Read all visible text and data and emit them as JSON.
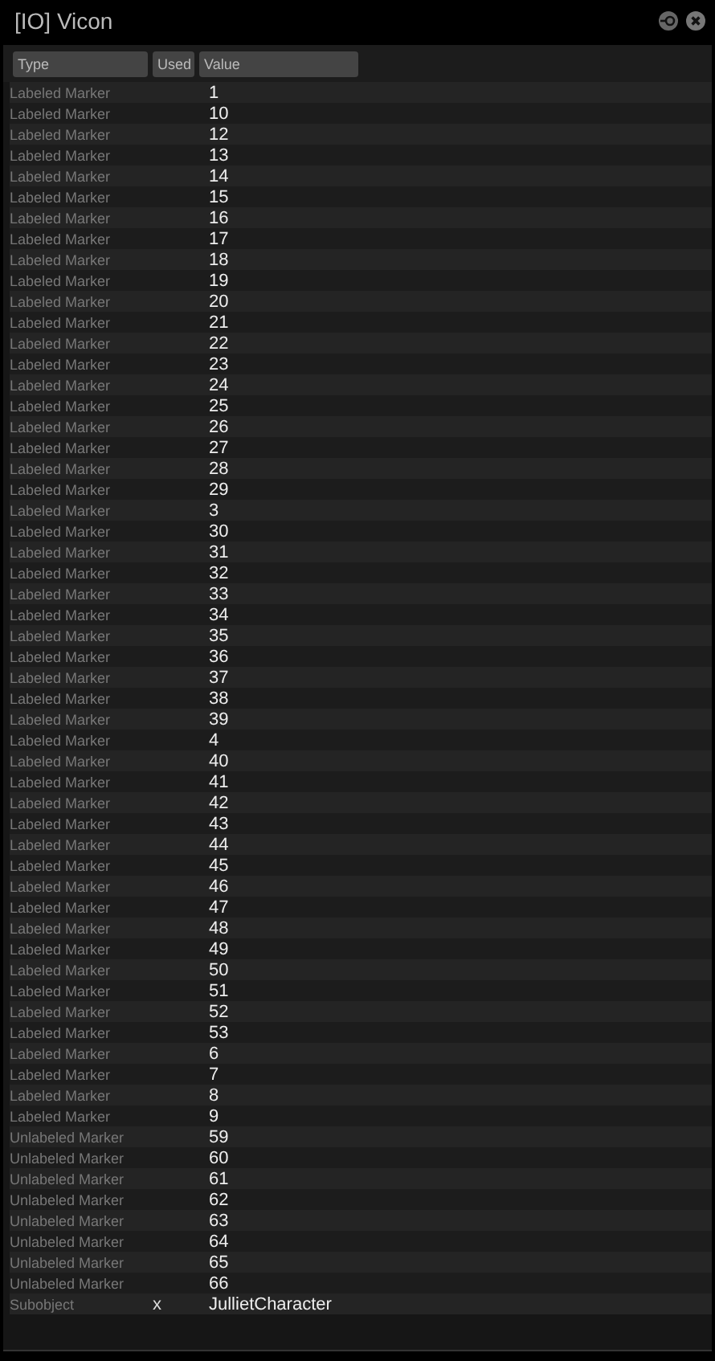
{
  "window": {
    "title": "[IO] Vicon"
  },
  "table": {
    "columns": [
      "Type",
      "Used",
      "Value"
    ],
    "rows": [
      {
        "type": "Labeled Marker",
        "value": "1"
      },
      {
        "type": "Labeled Marker",
        "value": "10"
      },
      {
        "type": "Labeled Marker",
        "value": "12"
      },
      {
        "type": "Labeled Marker",
        "value": "13"
      },
      {
        "type": "Labeled Marker",
        "value": "14"
      },
      {
        "type": "Labeled Marker",
        "value": "15"
      },
      {
        "type": "Labeled Marker",
        "value": "16"
      },
      {
        "type": "Labeled Marker",
        "value": "17"
      },
      {
        "type": "Labeled Marker",
        "value": "18"
      },
      {
        "type": "Labeled Marker",
        "value": "19"
      },
      {
        "type": "Labeled Marker",
        "value": "20"
      },
      {
        "type": "Labeled Marker",
        "value": "21"
      },
      {
        "type": "Labeled Marker",
        "value": "22"
      },
      {
        "type": "Labeled Marker",
        "value": "23"
      },
      {
        "type": "Labeled Marker",
        "value": "24"
      },
      {
        "type": "Labeled Marker",
        "value": "25"
      },
      {
        "type": "Labeled Marker",
        "value": "26"
      },
      {
        "type": "Labeled Marker",
        "value": "27"
      },
      {
        "type": "Labeled Marker",
        "value": "28"
      },
      {
        "type": "Labeled Marker",
        "value": "29"
      },
      {
        "type": "Labeled Marker",
        "value": "3"
      },
      {
        "type": "Labeled Marker",
        "value": "30"
      },
      {
        "type": "Labeled Marker",
        "value": "31"
      },
      {
        "type": "Labeled Marker",
        "value": "32"
      },
      {
        "type": "Labeled Marker",
        "value": "33"
      },
      {
        "type": "Labeled Marker",
        "value": "34"
      },
      {
        "type": "Labeled Marker",
        "value": "35"
      },
      {
        "type": "Labeled Marker",
        "value": "36"
      },
      {
        "type": "Labeled Marker",
        "value": "37"
      },
      {
        "type": "Labeled Marker",
        "value": "38"
      },
      {
        "type": "Labeled Marker",
        "value": "39"
      },
      {
        "type": "Labeled Marker",
        "value": "4"
      },
      {
        "type": "Labeled Marker",
        "value": "40"
      },
      {
        "type": "Labeled Marker",
        "value": "41"
      },
      {
        "type": "Labeled Marker",
        "value": "42"
      },
      {
        "type": "Labeled Marker",
        "value": "43"
      },
      {
        "type": "Labeled Marker",
        "value": "44"
      },
      {
        "type": "Labeled Marker",
        "value": "45"
      },
      {
        "type": "Labeled Marker",
        "value": "46"
      },
      {
        "type": "Labeled Marker",
        "value": "47"
      },
      {
        "type": "Labeled Marker",
        "value": "48"
      },
      {
        "type": "Labeled Marker",
        "value": "49"
      },
      {
        "type": "Labeled Marker",
        "value": "50"
      },
      {
        "type": "Labeled Marker",
        "value": "51"
      },
      {
        "type": "Labeled Marker",
        "value": "52"
      },
      {
        "type": "Labeled Marker",
        "value": "53"
      },
      {
        "type": "Labeled Marker",
        "value": "6"
      },
      {
        "type": "Labeled Marker",
        "value": "7"
      },
      {
        "type": "Labeled Marker",
        "value": "8"
      },
      {
        "type": "Labeled Marker",
        "value": "9"
      },
      {
        "type": "Unlabeled Marker",
        "value": "59"
      },
      {
        "type": "Unlabeled Marker",
        "value": "60"
      },
      {
        "type": "Unlabeled Marker",
        "value": "61"
      },
      {
        "type": "Unlabeled Marker",
        "value": "62"
      },
      {
        "type": "Unlabeled Marker",
        "value": "63"
      },
      {
        "type": "Unlabeled Marker",
        "value": "64"
      },
      {
        "type": "Unlabeled Marker",
        "value": "65"
      },
      {
        "type": "Unlabeled Marker",
        "value": "66"
      },
      {
        "type": "Subobject",
        "used": "x",
        "value": "JullietCharacter"
      }
    ]
  }
}
